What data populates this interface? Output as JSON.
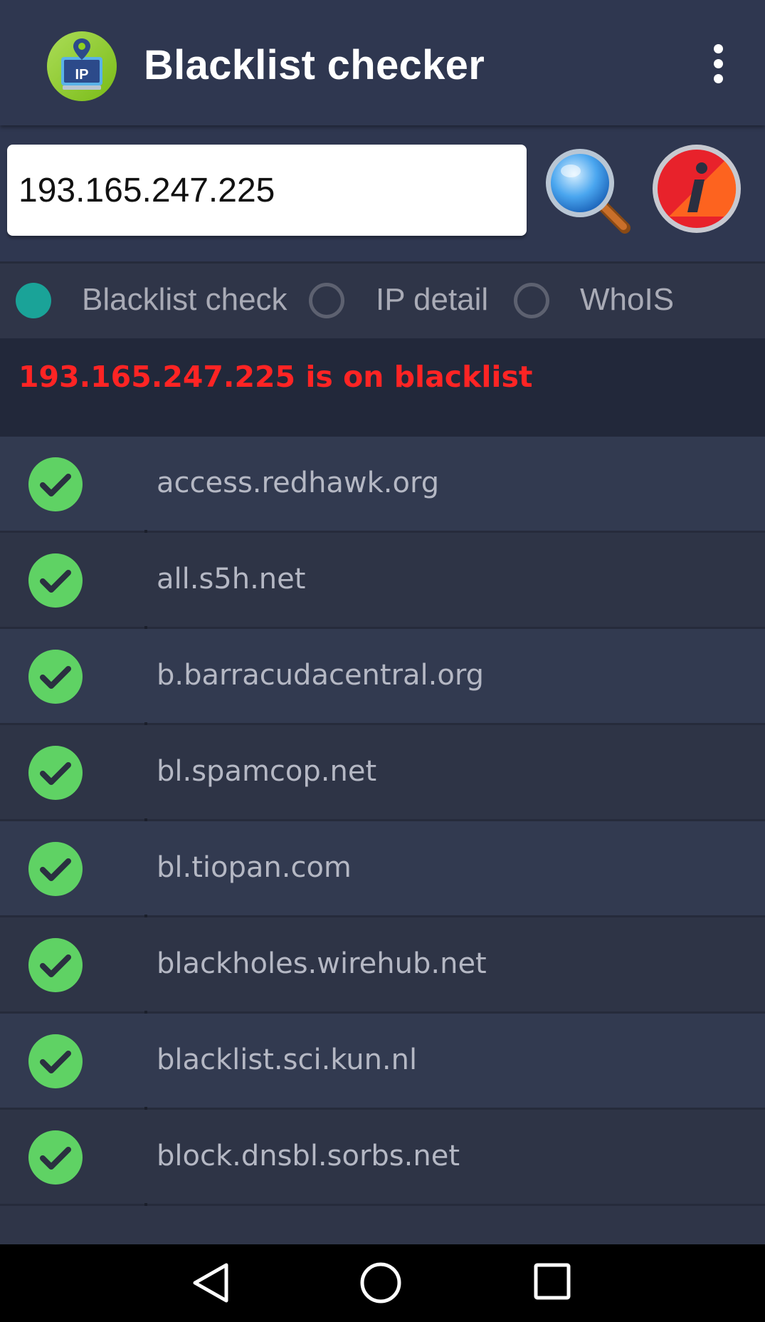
{
  "appbar": {
    "title": "Blacklist checker",
    "logo_text": "IP",
    "logo_icon": "ip-monitor-pin-logo",
    "menu_icon": "more-vert-icon"
  },
  "search": {
    "ip_value": "193.165.247.225",
    "search_icon": "magnifier-icon",
    "info_icon": "info-icon"
  },
  "modes": [
    {
      "label": "Blacklist check",
      "selected": true
    },
    {
      "label": "IP detail",
      "selected": false
    },
    {
      "label": "WhoIS",
      "selected": false
    }
  ],
  "status": {
    "text": "193.165.247.225 is on blacklist",
    "color": "#ff2424"
  },
  "blacklists": [
    {
      "name": "access.redhawk.org",
      "status": "ok"
    },
    {
      "name": "all.s5h.net",
      "status": "ok"
    },
    {
      "name": "b.barracudacentral.org",
      "status": "ok"
    },
    {
      "name": "bl.spamcop.net",
      "status": "ok"
    },
    {
      "name": "bl.tiopan.com",
      "status": "ok"
    },
    {
      "name": "blackholes.wirehub.net",
      "status": "ok"
    },
    {
      "name": "blacklist.sci.kun.nl",
      "status": "ok"
    },
    {
      "name": "block.dnsbl.sorbs.net",
      "status": "ok"
    }
  ],
  "colors": {
    "accent": "#1aa398",
    "ok_green": "#5fd264",
    "background": "#2f3548"
  },
  "navbar": {
    "back_icon": "back-triangle-icon",
    "home_icon": "home-circle-icon",
    "recents_icon": "recents-square-icon"
  }
}
